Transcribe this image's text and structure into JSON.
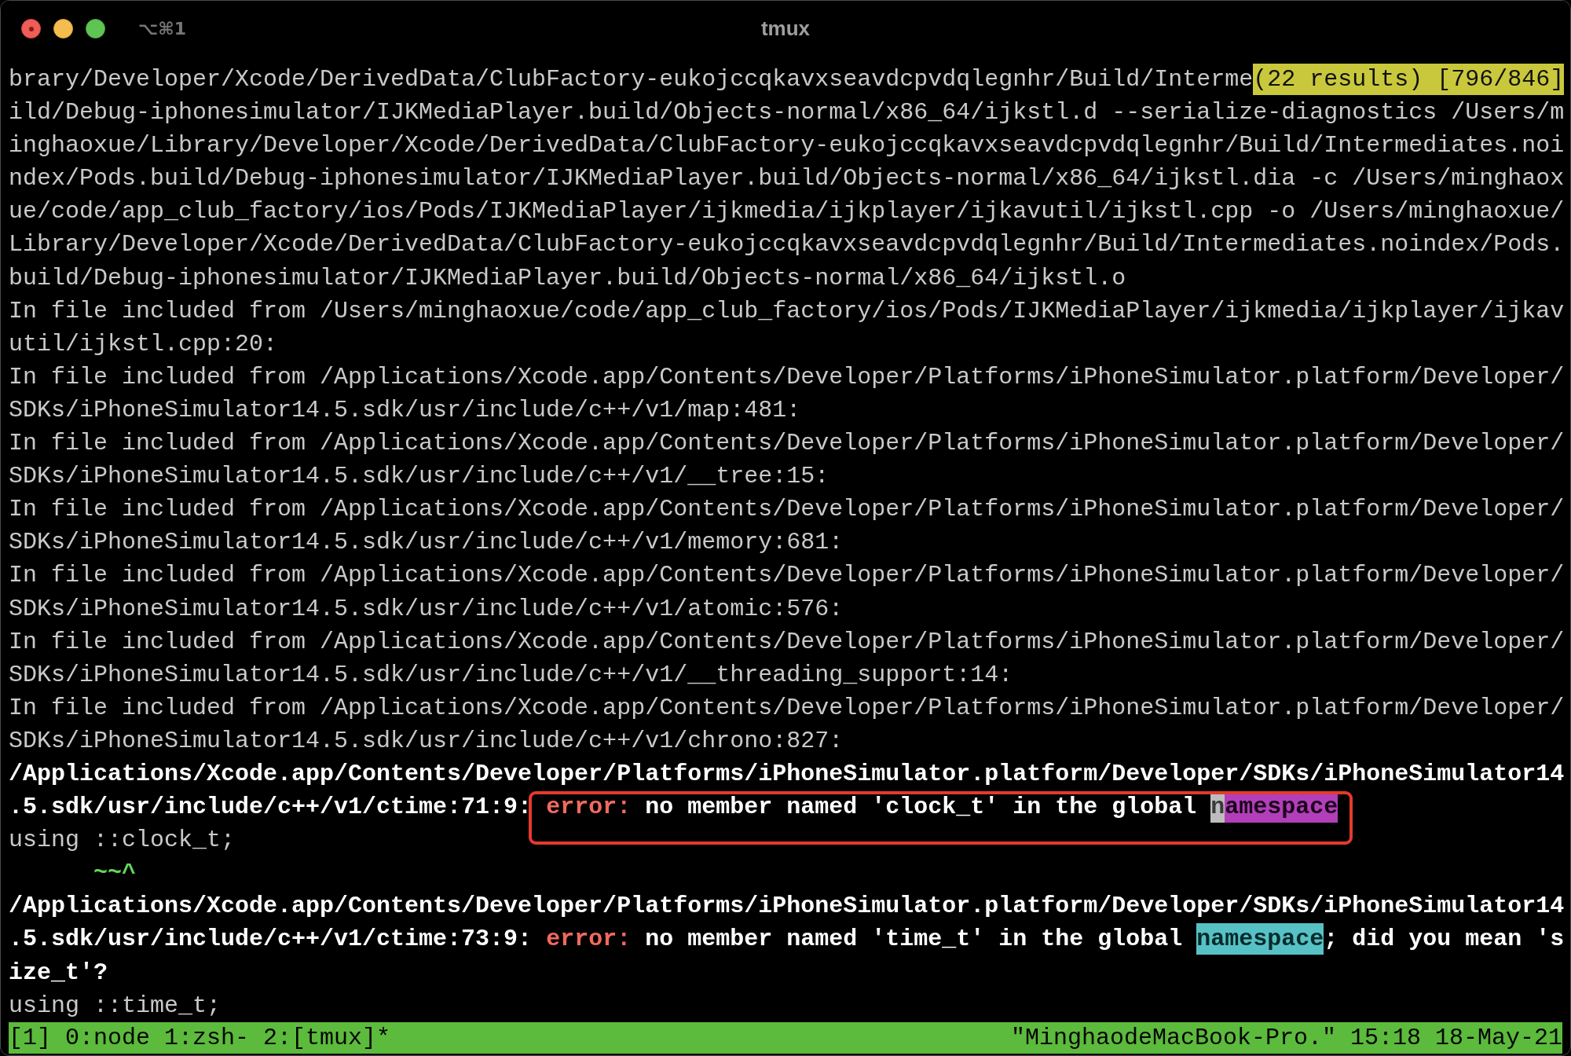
{
  "window": {
    "title": "tmux",
    "shortcut": "⌥⌘1",
    "buttons": [
      {
        "kind": "close",
        "edited": true
      },
      {
        "kind": "minimize",
        "edited": false
      },
      {
        "kind": "zoom",
        "edited": false
      }
    ]
  },
  "terminal": {
    "lines": [
      {
        "segments": [
          {
            "kind": "plain",
            "text": "brary/Developer/Xcode/DerivedData/ClubFactory-eukojccqkavxseavdcpvdqlegnhr/Build/Interme"
          },
          {
            "kind": "search-status",
            "text": "(22 results) [796/846]"
          }
        ]
      },
      {
        "segments": [
          {
            "kind": "plain",
            "text": "ild/Debug-iphonesimulator/IJKMediaPlayer.build/Objects-normal/x86_64/ijkstl.d --serialize-diagnostics /Users/m"
          }
        ]
      },
      {
        "segments": [
          {
            "kind": "plain",
            "text": "inghaoxue/Library/Developer/Xcode/DerivedData/ClubFactory-eukojccqkavxseavdcpvdqlegnhr/Build/Intermediates.noi"
          }
        ]
      },
      {
        "segments": [
          {
            "kind": "plain",
            "text": "ndex/Pods.build/Debug-iphonesimulator/IJKMediaPlayer.build/Objects-normal/x86_64/ijkstl.dia -c /Users/minghaox"
          }
        ]
      },
      {
        "segments": [
          {
            "kind": "plain",
            "text": "ue/code/app_club_factory/ios/Pods/IJKMediaPlayer/ijkmedia/ijkplayer/ijkavutil/ijkstl.cpp -o /Users/minghaoxue/"
          }
        ]
      },
      {
        "segments": [
          {
            "kind": "plain",
            "text": "Library/Developer/Xcode/DerivedData/ClubFactory-eukojccqkavxseavdcpvdqlegnhr/Build/Intermediates.noindex/Pods."
          }
        ]
      },
      {
        "segments": [
          {
            "kind": "plain",
            "text": "build/Debug-iphonesimulator/IJKMediaPlayer.build/Objects-normal/x86_64/ijkstl.o"
          }
        ]
      },
      {
        "segments": [
          {
            "kind": "plain",
            "text": "In file included from /Users/minghaoxue/code/app_club_factory/ios/Pods/IJKMediaPlayer/ijkmedia/ijkplayer/ijkav"
          }
        ]
      },
      {
        "segments": [
          {
            "kind": "plain",
            "text": "util/ijkstl.cpp:20:"
          }
        ]
      },
      {
        "segments": [
          {
            "kind": "plain",
            "text": "In file included from /Applications/Xcode.app/Contents/Developer/Platforms/iPhoneSimulator.platform/Developer/"
          }
        ]
      },
      {
        "segments": [
          {
            "kind": "plain",
            "text": "SDKs/iPhoneSimulator14.5.sdk/usr/include/c++/v1/map:481:"
          }
        ]
      },
      {
        "segments": [
          {
            "kind": "plain",
            "text": "In file included from /Applications/Xcode.app/Contents/Developer/Platforms/iPhoneSimulator.platform/Developer/"
          }
        ]
      },
      {
        "segments": [
          {
            "kind": "plain",
            "text": "SDKs/iPhoneSimulator14.5.sdk/usr/include/c++/v1/__tree:15:"
          }
        ]
      },
      {
        "segments": [
          {
            "kind": "plain",
            "text": "In file included from /Applications/Xcode.app/Contents/Developer/Platforms/iPhoneSimulator.platform/Developer/"
          }
        ]
      },
      {
        "segments": [
          {
            "kind": "plain",
            "text": "SDKs/iPhoneSimulator14.5.sdk/usr/include/c++/v1/memory:681:"
          }
        ]
      },
      {
        "segments": [
          {
            "kind": "plain",
            "text": "In file included from /Applications/Xcode.app/Contents/Developer/Platforms/iPhoneSimulator.platform/Developer/"
          }
        ]
      },
      {
        "segments": [
          {
            "kind": "plain",
            "text": "SDKs/iPhoneSimulator14.5.sdk/usr/include/c++/v1/atomic:576:"
          }
        ]
      },
      {
        "segments": [
          {
            "kind": "plain",
            "text": "In file included from /Applications/Xcode.app/Contents/Developer/Platforms/iPhoneSimulator.platform/Developer/"
          }
        ]
      },
      {
        "segments": [
          {
            "kind": "plain",
            "text": "SDKs/iPhoneSimulator14.5.sdk/usr/include/c++/v1/__threading_support:14:"
          }
        ]
      },
      {
        "segments": [
          {
            "kind": "plain",
            "text": "In file included from /Applications/Xcode.app/Contents/Developer/Platforms/iPhoneSimulator.platform/Developer/"
          }
        ]
      },
      {
        "segments": [
          {
            "kind": "plain",
            "text": "SDKs/iPhoneSimulator14.5.sdk/usr/include/c++/v1/chrono:827:"
          }
        ]
      },
      {
        "segments": [
          {
            "kind": "bold",
            "text": "/Applications/Xcode.app/Contents/Developer/Platforms/iPhoneSimulator.platform/Developer/SDKs/iPhoneSimulator14"
          }
        ]
      },
      {
        "segments": [
          {
            "kind": "bold",
            "text": ".5.sdk/usr/include/c++/v1/ctime:71:9: "
          },
          {
            "kind": "error",
            "text": "error:"
          },
          {
            "kind": "bold",
            "text": " no member named 'clock_t' in the global "
          },
          {
            "kind": "cursor",
            "text": "n"
          },
          {
            "kind": "current-match",
            "text": "amespace"
          }
        ]
      },
      {
        "segments": [
          {
            "kind": "plain",
            "text": "using ::clock_t;"
          }
        ]
      },
      {
        "segments": [
          {
            "kind": "caret",
            "text": "      ~~^"
          }
        ]
      },
      {
        "segments": [
          {
            "kind": "bold",
            "text": "/Applications/Xcode.app/Contents/Developer/Platforms/iPhoneSimulator.platform/Developer/SDKs/iPhoneSimulator14"
          }
        ]
      },
      {
        "segments": [
          {
            "kind": "bold",
            "text": ".5.sdk/usr/include/c++/v1/ctime:73:9: "
          },
          {
            "kind": "error",
            "text": "error:"
          },
          {
            "kind": "bold",
            "text": " no member named 'time_t' in the global "
          },
          {
            "kind": "match",
            "text": "namespace"
          },
          {
            "kind": "bold",
            "text": "; did you mean 's"
          }
        ]
      },
      {
        "segments": [
          {
            "kind": "bold",
            "text": "ize_t'?"
          }
        ]
      },
      {
        "segments": [
          {
            "kind": "plain",
            "text": "using ::time_t;"
          }
        ]
      }
    ]
  },
  "status_bar": {
    "session": "[1]",
    "windows": [
      {
        "label": "0:node"
      },
      {
        "label": "1:zsh-"
      },
      {
        "label": "2:[tmux]*"
      }
    ],
    "host": "\"MinghaodeMacBook-Pro.\"",
    "time": "15:18",
    "date": "18-May-21"
  }
}
